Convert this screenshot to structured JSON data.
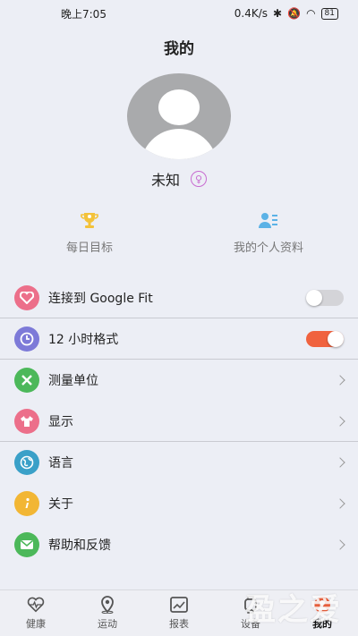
{
  "statusbar": {
    "time": "晚上7:05",
    "network_speed": "0.4K/s",
    "battery": "81"
  },
  "header": {
    "title": "我的"
  },
  "profile": {
    "name": "未知",
    "gender_icon": "female-icon"
  },
  "quick": [
    {
      "label": "每日目标",
      "icon": "trophy-icon"
    },
    {
      "label": "我的个人资料",
      "icon": "profile-icon"
    }
  ],
  "settings": [
    {
      "label": "连接到 Google Fit",
      "icon": "heart-icon",
      "color": "#ec6f8a",
      "control": "toggle",
      "on": false
    },
    {
      "label": "12 小时格式",
      "icon": "clock-icon",
      "color": "#7d7ad8",
      "control": "toggle",
      "on": true
    },
    {
      "label": "测量单位",
      "icon": "ruler-icon",
      "color": "#4cb85a"
    },
    {
      "label": "显示",
      "icon": "shirt-icon",
      "color": "#ec6f8a"
    },
    {
      "label": "语言",
      "icon": "globe-icon",
      "color": "#3aa0c8"
    },
    {
      "label": "关于",
      "icon": "info-icon",
      "color": "#f2b634"
    },
    {
      "label": "帮助和反馈",
      "icon": "mail-icon",
      "color": "#4cb85a"
    }
  ],
  "tabs": [
    {
      "label": "健康",
      "icon": "heartbeat-icon"
    },
    {
      "label": "运动",
      "icon": "location-icon"
    },
    {
      "label": "报表",
      "icon": "chart-icon"
    },
    {
      "label": "设备",
      "icon": "watch-icon"
    },
    {
      "label": "我的",
      "icon": "user-icon",
      "active": true
    }
  ],
  "watermark": "盈之爱",
  "colors": {
    "accent": "#f0623e",
    "toggle_off": "#d4d4d8"
  }
}
